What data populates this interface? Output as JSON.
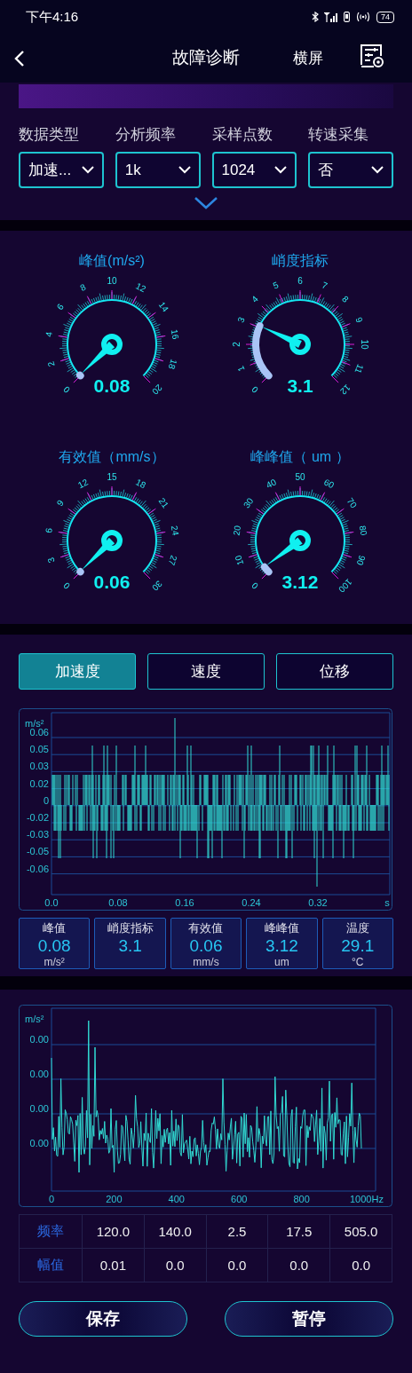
{
  "status_bar": {
    "time": "下午4:16",
    "battery": "74"
  },
  "header": {
    "title": "故障诊断",
    "landscape": "横屏"
  },
  "selectors": [
    {
      "label": "数据类型",
      "value": "加速..."
    },
    {
      "label": "分析频率",
      "value": "1k"
    },
    {
      "label": "采样点数",
      "value": "1024"
    },
    {
      "label": "转速采集",
      "value": "否"
    }
  ],
  "gauges": [
    {
      "title": "峰值(m/s²)",
      "value": "0.08",
      "ticks": [
        "0",
        "2",
        "4",
        "6",
        "8",
        "10",
        "12",
        "14",
        "16",
        "18",
        "20"
      ]
    },
    {
      "title": "峭度指标",
      "value": "3.1",
      "ticks": [
        "0",
        "1",
        "2",
        "3",
        "4",
        "5",
        "6",
        "7",
        "8",
        "9",
        "10",
        "11",
        "12"
      ]
    },
    {
      "title": "有效值（mm/s）",
      "value": "0.06",
      "ticks": [
        "0",
        "3",
        "6",
        "9",
        "12",
        "15",
        "18",
        "21",
        "24",
        "27",
        "30"
      ]
    },
    {
      "title": "峰峰值（ um ）",
      "value": "3.12",
      "ticks": [
        "0",
        "10",
        "20",
        "30",
        "40",
        "50",
        "60",
        "70",
        "80",
        "90",
        "100"
      ]
    }
  ],
  "tabs": [
    {
      "label": "加速度",
      "selected": true
    },
    {
      "label": "速度",
      "selected": false
    },
    {
      "label": "位移",
      "selected": false
    }
  ],
  "waveform": {
    "unit": "m/s²",
    "y_labels": [
      "0.06",
      "0.05",
      "0.03",
      "0.02",
      "0",
      "-0.02",
      "-0.03",
      "-0.05",
      "-0.06"
    ],
    "x_labels": [
      "0.0",
      "0.08",
      "0.16",
      "0.24",
      "0.32"
    ],
    "x_unit": "s"
  },
  "stats": [
    {
      "label": "峰值",
      "value": "0.08",
      "unit": "m/s²"
    },
    {
      "label": "峭度指标",
      "value": "3.1"
    },
    {
      "label": "有效值",
      "value": "0.06",
      "unit": "mm/s"
    },
    {
      "label": "峰峰值",
      "value": "3.12",
      "unit": "um"
    },
    {
      "label": "温度",
      "value": "29.1",
      "unit": "°C"
    }
  ],
  "spectrum": {
    "unit": "m/s²",
    "y_labels": [
      "0.00",
      "0.00",
      "0.00",
      "0.00"
    ],
    "x_labels": [
      "0",
      "200",
      "400",
      "600",
      "800",
      "1000Hz"
    ]
  },
  "peaks_table": {
    "rows": [
      {
        "header": "频率",
        "cells": [
          "120.0",
          "140.0",
          "2.5",
          "17.5",
          "505.0"
        ]
      },
      {
        "header": "幅值",
        "cells": [
          "0.01",
          "0.0",
          "0.0",
          "0.0",
          "0.0"
        ]
      }
    ]
  },
  "buttons": [
    "保存",
    "暂停"
  ]
}
